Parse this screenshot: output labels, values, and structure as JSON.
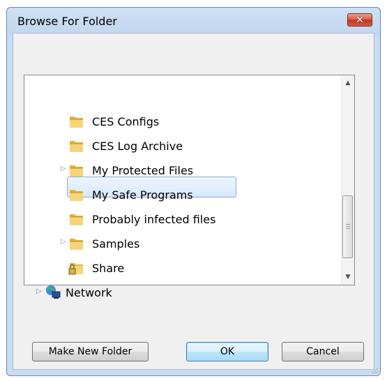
{
  "window": {
    "title": "Browse For Folder",
    "close_symbol": "✕"
  },
  "tree": {
    "items": [
      {
        "label": "CES Configs",
        "icon": "folder-icon",
        "expander": false
      },
      {
        "label": "CES Log Archive",
        "icon": "folder-icon",
        "expander": false
      },
      {
        "label": "My Protected Files",
        "icon": "folder-icon",
        "expander": true
      },
      {
        "label": "My Safe Programs",
        "icon": "folder-icon",
        "expander": false
      },
      {
        "label": "Probably infected files",
        "icon": "folder-icon",
        "expander": false,
        "selected": true
      },
      {
        "label": "Samples",
        "icon": "folder-icon",
        "expander": true
      },
      {
        "label": "Share",
        "icon": "shared-folder-icon",
        "expander": false
      },
      {
        "label": "Network",
        "icon": "network-icon",
        "expander": true
      }
    ]
  },
  "buttons": {
    "make_new_folder": "Make New Folder",
    "ok": "OK",
    "cancel": "Cancel"
  },
  "colors": {
    "title_bar": "#c1d6ee",
    "selection": "#d8e8fb",
    "close_button": "#c2361a",
    "folder": "#f0c050"
  }
}
